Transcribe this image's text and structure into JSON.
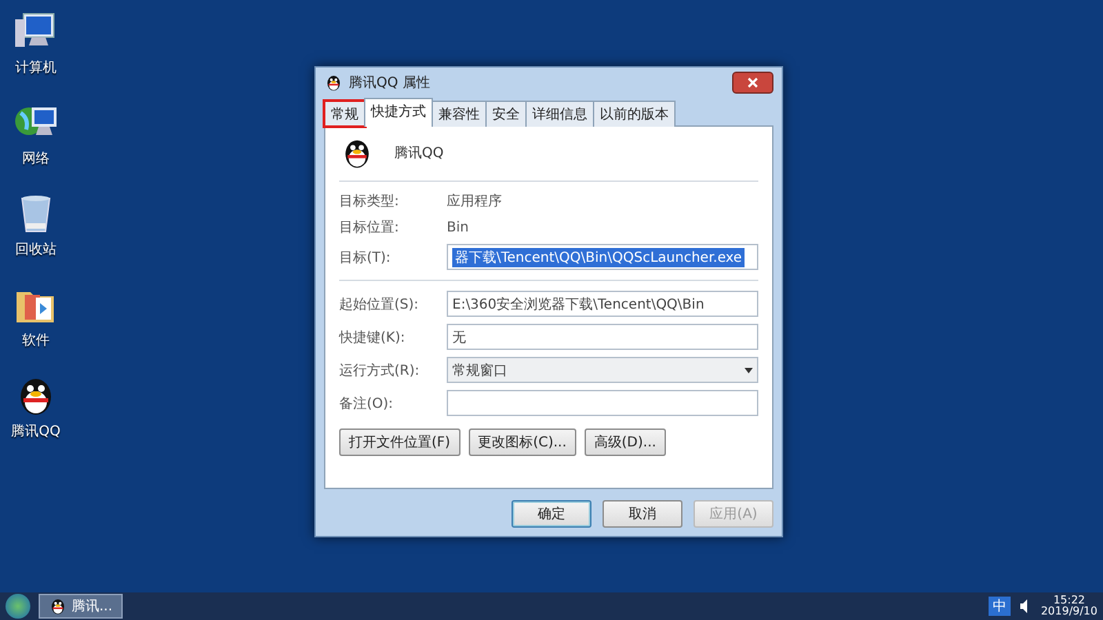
{
  "desktop_icons": [
    {
      "label": "计算机",
      "kind": "computer"
    },
    {
      "label": "网络",
      "kind": "network"
    },
    {
      "label": "回收站",
      "kind": "recycle"
    },
    {
      "label": "软件",
      "kind": "folder"
    },
    {
      "label": "腾讯QQ",
      "kind": "qq"
    }
  ],
  "dialog": {
    "title": "腾讯QQ 属性",
    "tabs": [
      {
        "label": "常规",
        "selected": false,
        "annotated": true
      },
      {
        "label": "快捷方式",
        "selected": true,
        "annotated": false
      },
      {
        "label": "兼容性",
        "selected": false,
        "annotated": false
      },
      {
        "label": "安全",
        "selected": false,
        "annotated": false
      },
      {
        "label": "详细信息",
        "selected": false,
        "annotated": false
      },
      {
        "label": "以前的版本",
        "selected": false,
        "annotated": false
      }
    ],
    "name": "腾讯QQ",
    "info": [
      {
        "label": "目标类型:",
        "value": "应用程序"
      },
      {
        "label": "目标位置:",
        "value": "Bin"
      }
    ],
    "target": {
      "label": "目标(T):",
      "value": "器下载\\Tencent\\QQ\\Bin\\QQScLauncher.exe"
    },
    "fields": [
      {
        "label": "起始位置(S):",
        "value": "E:\\360安全浏览器下载\\Tencent\\QQ\\Bin",
        "kind": "text"
      },
      {
        "label": "快捷键(K):",
        "value": "无",
        "kind": "text"
      },
      {
        "label": "运行方式(R):",
        "value": "常规窗口",
        "kind": "dropdown"
      },
      {
        "label": "备注(O):",
        "kind": "text"
      }
    ],
    "actions": [
      "打开文件位置(F)",
      "更改图标(C)...",
      "高级(D)..."
    ],
    "buttons": [
      {
        "label": "确定",
        "disabled": false,
        "default": true
      },
      {
        "label": "取消",
        "disabled": false,
        "default": false
      },
      {
        "label": "应用(A)",
        "disabled": true,
        "default": false
      }
    ]
  },
  "taskbar": {
    "task": "腾讯...",
    "ime": "中",
    "time": "15:22",
    "date": "2019/9/10"
  }
}
